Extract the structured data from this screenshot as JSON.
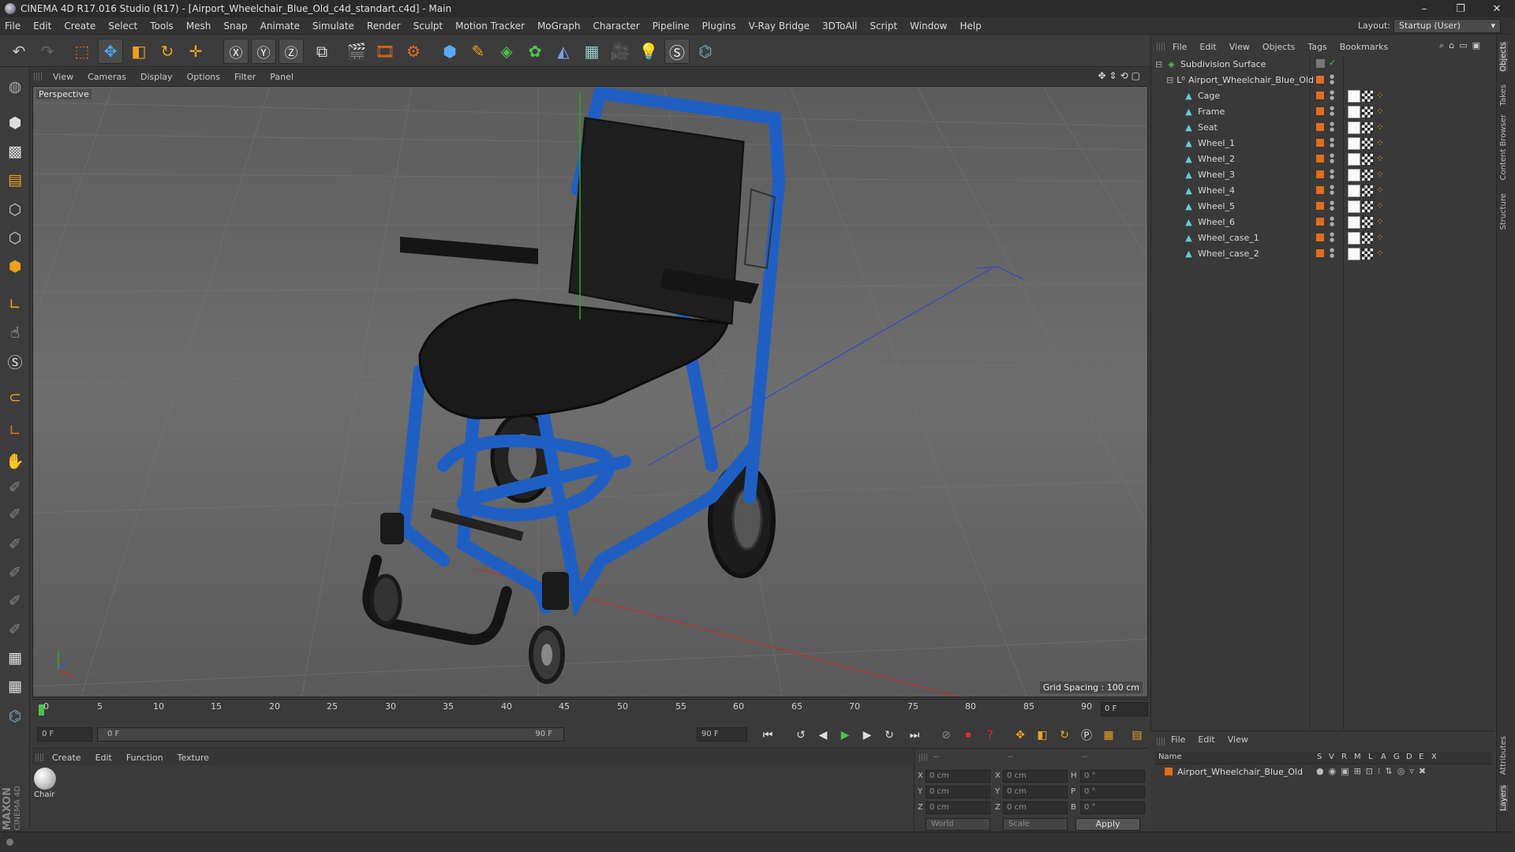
{
  "window": {
    "title": "CINEMA 4D R17.016 Studio (R17) - [Airport_Wheelchair_Blue_Old_c4d_standart.c4d] - Main",
    "controls": [
      "–",
      "❐",
      "✕"
    ]
  },
  "menubar": {
    "items": [
      "File",
      "Edit",
      "Create",
      "Select",
      "Tools",
      "Mesh",
      "Snap",
      "Animate",
      "Simulate",
      "Render",
      "Sculpt",
      "Motion Tracker",
      "MoGraph",
      "Character",
      "Pipeline",
      "Plugins",
      "V-Ray Bridge",
      "3DToAll",
      "Script",
      "Window",
      "Help"
    ],
    "layout_label": "Layout:",
    "layout_value": "Startup (User)"
  },
  "viewport": {
    "menu": [
      "View",
      "Cameras",
      "Display",
      "Options",
      "Filter",
      "Panel"
    ],
    "label": "Perspective",
    "grid_spacing": "Grid Spacing : 100 cm"
  },
  "timeline": {
    "ticks": [
      "0",
      "5",
      "10",
      "15",
      "20",
      "25",
      "30",
      "35",
      "40",
      "45",
      "50",
      "55",
      "60",
      "65",
      "70",
      "75",
      "80",
      "85",
      "90"
    ],
    "current_frame": "0 F",
    "start_field": "0 F",
    "range_start": "0 F",
    "range_end": "90 F",
    "end_field": "90 F"
  },
  "material_manager": {
    "menu": [
      "Create",
      "Edit",
      "Function",
      "Texture"
    ],
    "materials": [
      {
        "name": "Chair"
      }
    ]
  },
  "coordinates": {
    "header_left": "--",
    "header_mid": "--",
    "header_right": "--",
    "rows": [
      {
        "a": "X",
        "av": "0 cm",
        "b": "X",
        "bv": "0 cm",
        "c": "H",
        "cv": "0 °"
      },
      {
        "a": "Y",
        "av": "0 cm",
        "b": "Y",
        "bv": "0 cm",
        "c": "P",
        "cv": "0 °"
      },
      {
        "a": "Z",
        "av": "0 cm",
        "b": "Z",
        "bv": "0 cm",
        "c": "B",
        "cv": "0 °"
      }
    ],
    "mode": "World",
    "transform": "Scale",
    "apply": "Apply"
  },
  "object_manager": {
    "menu": [
      "File",
      "Edit",
      "View",
      "Objects",
      "Tags",
      "Bookmarks"
    ],
    "objects": [
      {
        "name": "Subdivision Surface",
        "level": 0
      },
      {
        "name": "Airport_Wheelchair_Blue_Old",
        "level": 1
      },
      {
        "name": "Cage",
        "level": 2
      },
      {
        "name": "Frame",
        "level": 2
      },
      {
        "name": "Seat",
        "level": 2
      },
      {
        "name": "Wheel_1",
        "level": 2
      },
      {
        "name": "Wheel_2",
        "level": 2
      },
      {
        "name": "Wheel_3",
        "level": 2
      },
      {
        "name": "Wheel_4",
        "level": 2
      },
      {
        "name": "Wheel_5",
        "level": 2
      },
      {
        "name": "Wheel_6",
        "level": 2
      },
      {
        "name": "Wheel_case_1",
        "level": 2
      },
      {
        "name": "Wheel_case_2",
        "level": 2
      }
    ]
  },
  "layer_manager": {
    "menu": [
      "File",
      "Edit",
      "View"
    ],
    "columns": [
      "Name",
      "S",
      "V",
      "R",
      "M",
      "L",
      "A",
      "G",
      "D",
      "E",
      "X"
    ],
    "layers": [
      {
        "name": "Airport_Wheelchair_Blue_Old"
      }
    ]
  },
  "right_tabs": [
    "Objects",
    "Takes",
    "Content Browser",
    "Structure",
    "Attributes",
    "Layers"
  ],
  "brand": {
    "line1": "MAXON",
    "line2": "CINEMA 4D"
  },
  "colors": {
    "accent": "#e36d1a",
    "chair_blue": "#1f5fc4",
    "bg": "#3a3a3a"
  }
}
